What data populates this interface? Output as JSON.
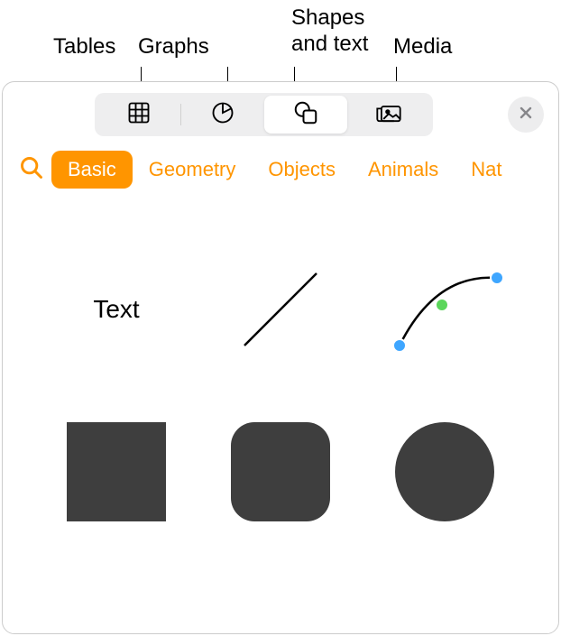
{
  "callouts": {
    "tables": "Tables",
    "graphs": "Graphs",
    "shapes_text": "Shapes\nand text",
    "media": "Media"
  },
  "toolbar": {
    "items": [
      "tables",
      "graphs",
      "shapes",
      "media"
    ],
    "active_index": 2
  },
  "categories": {
    "items": [
      "Basic",
      "Geometry",
      "Objects",
      "Animals",
      "Nat"
    ],
    "active_index": 0
  },
  "shapes": {
    "text_label": "Text"
  }
}
